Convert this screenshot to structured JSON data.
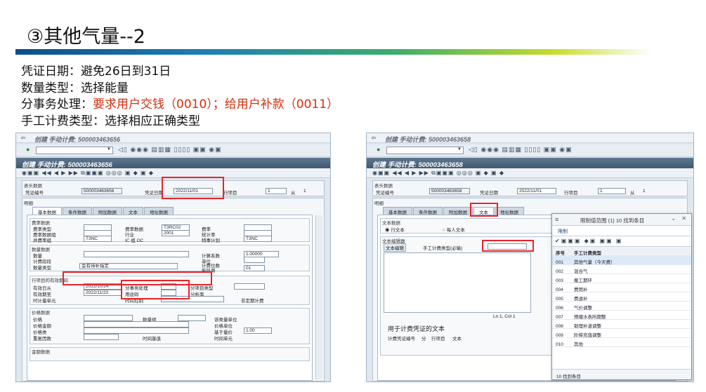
{
  "slide": {
    "title": "③其他气量--2",
    "bullets": [
      {
        "label": "凭证日期：",
        "text": "避免26日到31日",
        "red": ""
      },
      {
        "label": "数量类型：",
        "text": "选择能量",
        "red": ""
      },
      {
        "label": "分事务处理：",
        "text": "",
        "red": "要求用户交钱（0010）；给用户补款（0011）"
      },
      {
        "label": "手工计费类型：",
        "text": "选择相应正确类型",
        "red": ""
      }
    ]
  },
  "left": {
    "frame_title": "创建 手动计费: 500003463656",
    "tx_title": "创建 手动计费: 500003463656",
    "header": {
      "group": "表头数据",
      "doc_no_label": "凭证编号",
      "doc_no": "500003463656",
      "date_label": "凭证日期",
      "date": "2022/11/01",
      "item_label": "行项目",
      "item": "1",
      "from_label": "从",
      "from": "1"
    },
    "main_group": "明细",
    "tabs": [
      "基本数据",
      "条件数据",
      "附加数据",
      "文本",
      "地址数据"
    ],
    "rate_group": {
      "title": "费率数据",
      "l1": "费率类型",
      "l2": "费率数据",
      "v2": "T3RC02",
      "l3": "费率",
      "l4": "费率数据组",
      "l5": "行业",
      "v5": "2001",
      "l6": "统计率",
      "l7": "并费率组",
      "v7": "T3NC",
      "l8": "IC 组 OC",
      "l9": "特事计划",
      "v9": "T3NC"
    },
    "qty_group": {
      "title": "数量数据",
      "l1": "数量",
      "l2": "计算系数",
      "v2": "1.00000",
      "l3": "计费段段",
      "l4": "单位",
      "l5": "数量类型",
      "v5": "会有待补指定",
      "l6": "计费位数",
      "l7": "能段周",
      "v7": "01"
    },
    "period_group": {
      "title": "行项目的有效期间",
      "l1": "有效日从",
      "v1": "2022/10/24",
      "l2": "分事务处理",
      "l3": "分项目类型",
      "l4": "有效期至",
      "v4": "2022/11/23",
      "l5": "用途码",
      "l6": "分析率",
      "l7": "时计量单元",
      "l8": "时间控制",
      "l9": "非定期计费"
    },
    "price_group": {
      "title": "价格数据",
      "l1": "价格",
      "l2": "数量组",
      "l3": "该类量单位",
      "l4": "价格金额",
      "l5": "价格单位",
      "l6": "价格类",
      "l7": "基于量价",
      "v7": "1.00",
      "l8": "重复因数",
      "l9": "时间基值",
      "l10": "时间单元"
    },
    "amount_group": {
      "title": "金额数据"
    }
  },
  "right": {
    "frame_title": "创建 手动计费: 500003463658",
    "tx_title": "创建 手动计费: 500003463658",
    "header": {
      "group": "表头数据",
      "doc_no_label": "凭证编号",
      "doc_no": "500003463658",
      "date_label": "凭证日期",
      "date": "2022/11/01",
      "item_label": "行项目",
      "item": "1",
      "from_label": "从",
      "from": "1"
    },
    "main_group": "明细",
    "tabs": [
      "基本数据",
      "条件数据",
      "附加数据",
      "文本",
      "地址数据"
    ],
    "text_group": {
      "title": "文本数据",
      "radio1": "行文本",
      "radio2": "每人文本"
    },
    "editor": {
      "title": "文本编辑器",
      "btn": "文本编辑",
      "type_label": "手工计费类型(必输)",
      "pos": "Ln 1, Col 1",
      "caption": "用于计费凭证的文本",
      "footer": [
        "计费凭证编号",
        "分",
        "行项目",
        "文本"
      ]
    },
    "popup": {
      "title": "限制值范围 (1)  10 找到条目",
      "tab": "限制",
      "col1": "序号",
      "col2": "手工计费类型",
      "rows": [
        {
          "code": "001",
          "text": "其他气量（今天费）"
        },
        {
          "code": "002",
          "text": "混合气"
        },
        {
          "code": "003",
          "text": "搬工期环"
        },
        {
          "code": "004",
          "text": "费用补"
        },
        {
          "code": "005",
          "text": "费退补"
        },
        {
          "code": "006",
          "text": "气价调整"
        },
        {
          "code": "007",
          "text": "预缴水表所期整"
        },
        {
          "code": "008",
          "text": "助理补退调整"
        },
        {
          "code": "009",
          "text": "阶梯充值调整"
        },
        {
          "code": "010",
          "text": "其他"
        }
      ],
      "footer": "10 找到条目"
    }
  },
  "colors": {
    "accent_red": "#d42f0e",
    "highlight_red": "#e8242a",
    "sap_title": "#4d6680"
  }
}
